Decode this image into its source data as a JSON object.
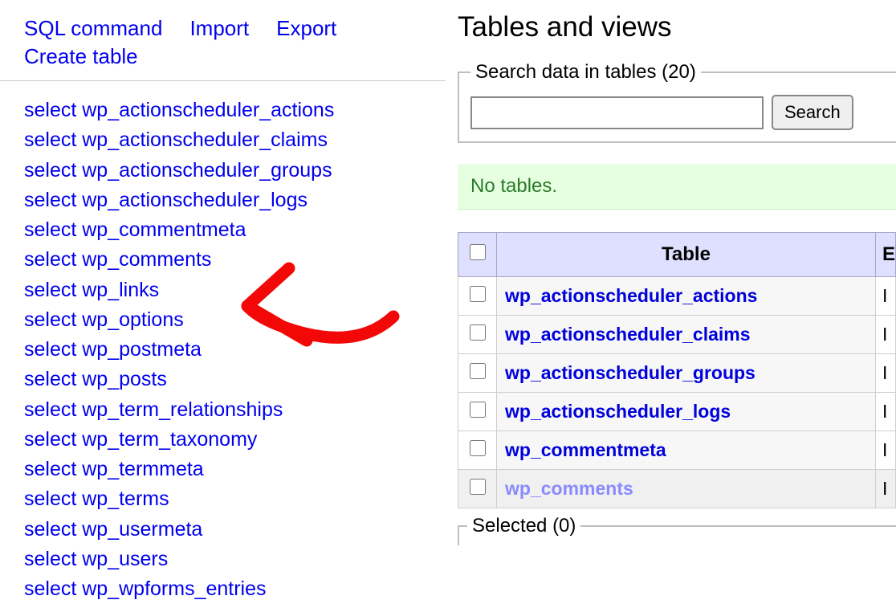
{
  "topLinks": {
    "sql": "SQL command",
    "import": "Import",
    "export": "Export",
    "create": "Create table"
  },
  "sidebarTables": [
    "select wp_actionscheduler_actions",
    "select wp_actionscheduler_claims",
    "select wp_actionscheduler_groups",
    "select wp_actionscheduler_logs",
    "select wp_commentmeta",
    "select wp_comments",
    "select wp_links",
    "select wp_options",
    "select wp_postmeta",
    "select wp_posts",
    "select wp_term_relationships",
    "select wp_term_taxonomy",
    "select wp_termmeta",
    "select wp_terms",
    "select wp_usermeta",
    "select wp_users",
    "select wp_wpforms_entries"
  ],
  "main": {
    "heading": "Tables and views",
    "searchLegend": "Search data in tables (20)",
    "searchButton": "Search",
    "notice": "No tables.",
    "columns": {
      "table": "Table",
      "engine": "E"
    },
    "rows": [
      {
        "name": "wp_actionscheduler_actions",
        "engine": "I"
      },
      {
        "name": "wp_actionscheduler_claims",
        "engine": "I"
      },
      {
        "name": "wp_actionscheduler_groups",
        "engine": "I"
      },
      {
        "name": "wp_actionscheduler_logs",
        "engine": "I"
      },
      {
        "name": "wp_commentmeta",
        "engine": "I"
      },
      {
        "name": "wp_comments",
        "engine": "I"
      }
    ],
    "selectedLegend": "Selected (0)"
  }
}
